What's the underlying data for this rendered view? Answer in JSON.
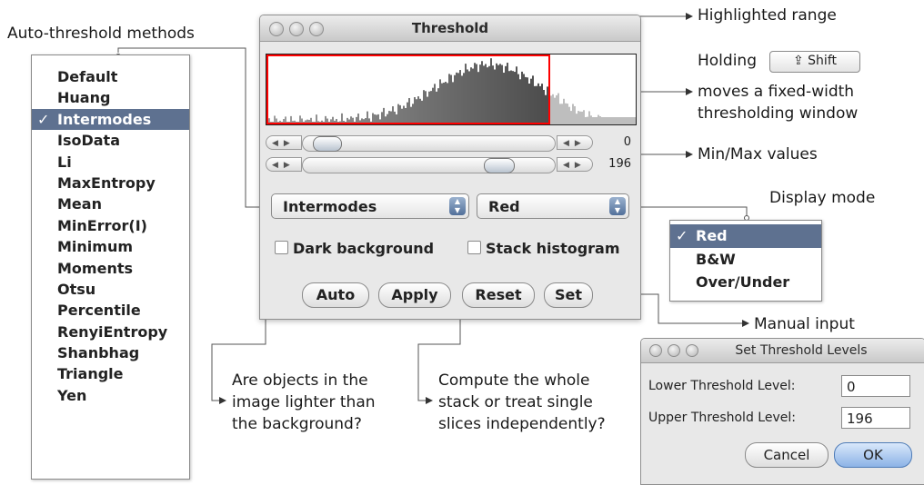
{
  "annotations": {
    "auto_methods": "Auto-threshold methods",
    "highlighted_range": "Highlighted range",
    "holding": "Holding",
    "shift_key": "⇪ Shift",
    "moves_line1": "moves a fixed-width",
    "moves_line2": "thresholding window",
    "min_max": "Min/Max values",
    "display_mode": "Display mode",
    "manual_input": "Manual input",
    "dark_question_1": "Are objects in the",
    "dark_question_2": "image lighter than",
    "dark_question_3": "the background?",
    "stack_question_1": "Compute the whole",
    "stack_question_2": "stack or treat single",
    "stack_question_3": "slices independently?"
  },
  "methods_menu": {
    "items": [
      "Default",
      "Huang",
      "Intermodes",
      "IsoData",
      "Li",
      "MaxEntropy",
      "Mean",
      "MinError(I)",
      "Minimum",
      "Moments",
      "Otsu",
      "Percentile",
      "RenyiEntropy",
      "Shanbhag",
      "Triangle",
      "Yen"
    ],
    "selected": "Intermodes",
    "check": "✓",
    "selected_color": "#5e7190"
  },
  "threshold_window": {
    "title": "Threshold",
    "min_value": "0",
    "max_value": "196",
    "method_popup": "Intermodes",
    "display_popup": "Red",
    "dark_background_label": "Dark background",
    "stack_histogram_label": "Stack histogram",
    "buttons": [
      "Auto",
      "Apply",
      "Reset",
      "Set"
    ],
    "threshold_color": "#ff0000"
  },
  "display_menu": {
    "items": [
      "Red",
      "B&W",
      "Over/Under"
    ],
    "selected": "Red",
    "check": "✓"
  },
  "set_dialog": {
    "title": "Set Threshold Levels",
    "lower_label": "Lower Threshold Level:",
    "lower_value": "0",
    "upper_label": "Upper Threshold Level:",
    "upper_value": "196",
    "cancel": "Cancel",
    "ok": "OK"
  }
}
